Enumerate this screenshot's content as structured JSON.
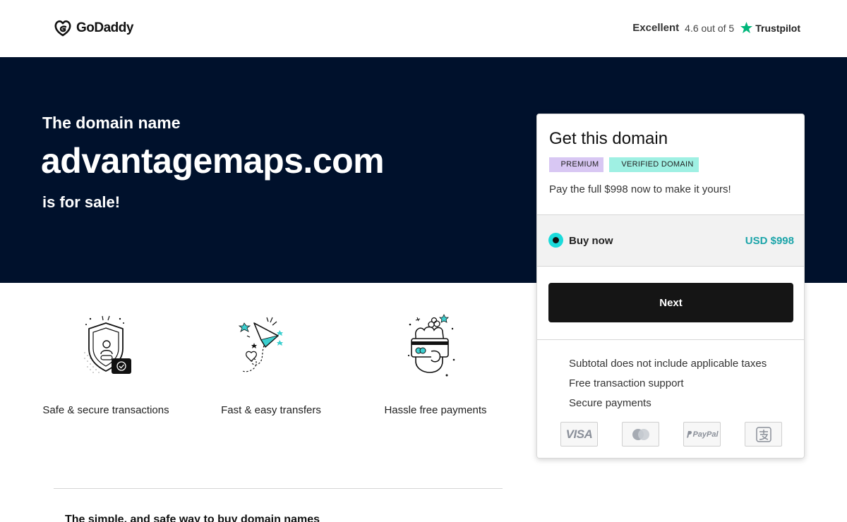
{
  "header": {
    "brand": "GoDaddy",
    "rating_label": "Excellent",
    "rating_score": "4.6 out of 5",
    "review_site": "Trustpilot"
  },
  "hero": {
    "lead": "The domain name",
    "domain": "advantagemaps.com",
    "status": "is for sale!"
  },
  "features": [
    {
      "icon": "shield-icon",
      "label": "Safe & secure transactions"
    },
    {
      "icon": "paper-plane-icon",
      "label": "Fast & easy transfers"
    },
    {
      "icon": "card-payment-icon",
      "label": "Hassle free payments"
    }
  ],
  "footer_heading": "The simple, and safe way to buy domain names",
  "card": {
    "title": "Get this domain",
    "badges": [
      "PREMIUM",
      "VERIFIED DOMAIN"
    ],
    "description": "Pay the full $998 now to make it yours!",
    "option_label": "Buy now",
    "option_price": "USD $998",
    "next_label": "Next",
    "info": [
      "Subtotal does not include applicable taxes",
      "Free transaction support",
      "Secure payments"
    ],
    "payment_methods": [
      {
        "icon": "visa-icon",
        "label": "VISA"
      },
      {
        "icon": "mastercard-icon",
        "label": ""
      },
      {
        "icon": "paypal-icon",
        "label": "PayPal"
      },
      {
        "icon": "alipay-icon",
        "label": ""
      }
    ]
  },
  "colors": {
    "hero_bg": "#00112c",
    "accent_teal": "#1ba4a9",
    "radio_teal": "#1bdbdb",
    "premium_badge": "#d8c7f3",
    "verified_badge": "#9ff0e3",
    "button_bg": "#151515",
    "trustpilot_green": "#00b67a"
  }
}
